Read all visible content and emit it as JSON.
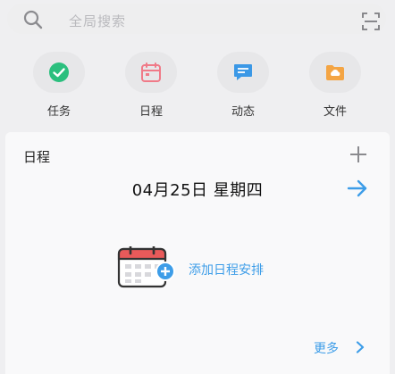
{
  "search": {
    "placeholder": "全局搜索"
  },
  "quick_actions": [
    {
      "label": "任务",
      "icon": "check-circle-icon",
      "color": "#2bbf7e"
    },
    {
      "label": "日程",
      "icon": "calendar-icon",
      "color": "#f07a88"
    },
    {
      "label": "动态",
      "icon": "message-icon",
      "color": "#3b98e6"
    },
    {
      "label": "文件",
      "icon": "folder-icon",
      "color": "#f4a544"
    }
  ],
  "schedule_card": {
    "title": "日程",
    "date": "04月25日 星期四",
    "add_schedule": "添加日程安排",
    "more": "更多"
  },
  "colors": {
    "accent": "#3d9de8",
    "background": "#efeff1",
    "card": "#f9f9fa"
  }
}
